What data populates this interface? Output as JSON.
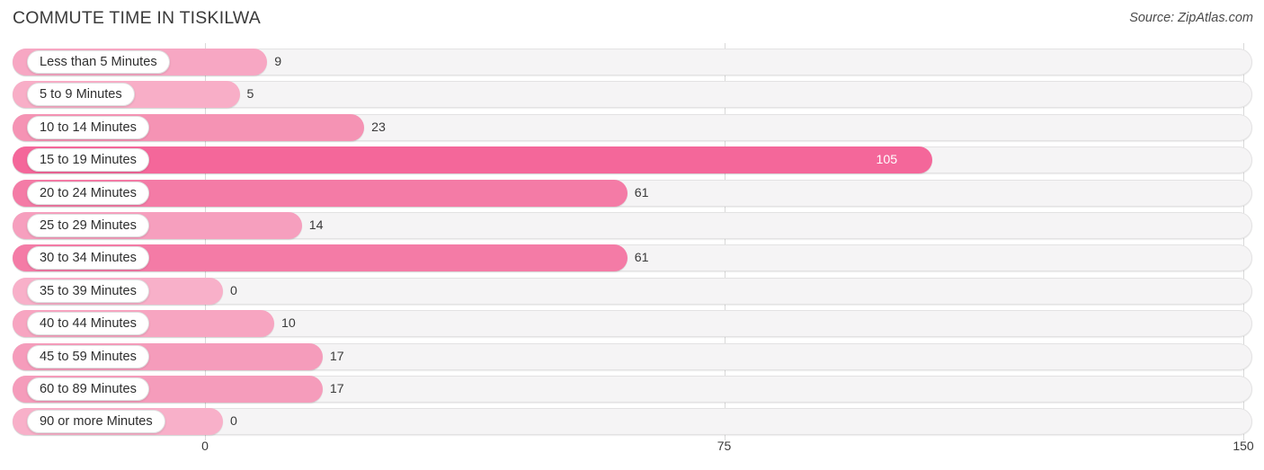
{
  "header": {
    "title": "COMMUTE TIME IN TISKILWA",
    "source": "Source: ZipAtlas.com"
  },
  "chart_data": {
    "type": "bar",
    "orientation": "horizontal",
    "title": "COMMUTE TIME IN TISKILWA",
    "xlabel": "",
    "ylabel": "",
    "xlim": [
      0,
      150
    ],
    "ticks": [
      "0",
      "75",
      "150"
    ],
    "tick_values": [
      0,
      75,
      150
    ],
    "grid": true,
    "legend": "none",
    "categories": [
      "Less than 5 Minutes",
      "5 to 9 Minutes",
      "10 to 14 Minutes",
      "15 to 19 Minutes",
      "20 to 24 Minutes",
      "25 to 29 Minutes",
      "30 to 34 Minutes",
      "35 to 39 Minutes",
      "40 to 44 Minutes",
      "45 to 59 Minutes",
      "60 to 89 Minutes",
      "90 or more Minutes"
    ],
    "values": [
      9,
      5,
      23,
      105,
      61,
      14,
      61,
      0,
      10,
      17,
      17,
      0
    ],
    "value_labels": [
      "9",
      "5",
      "23",
      "105",
      "61",
      "14",
      "61",
      "0",
      "10",
      "17",
      "17",
      "0"
    ],
    "bar_colors": [
      "#f7a7c3",
      "#f8aec7",
      "#f593b4",
      "#f4679a",
      "#f47ba6",
      "#f69fbe",
      "#f47ba6",
      "#f8b0c9",
      "#f7a5c1",
      "#f59cbb",
      "#f59cbb",
      "#f8b0c9"
    ]
  },
  "colors": {
    "accent": "#f4679a",
    "track": "#f5f4f5",
    "track_border": "#e3e2e3",
    "gridline": "#d9d9d9",
    "text": "#3a3a3a"
  }
}
